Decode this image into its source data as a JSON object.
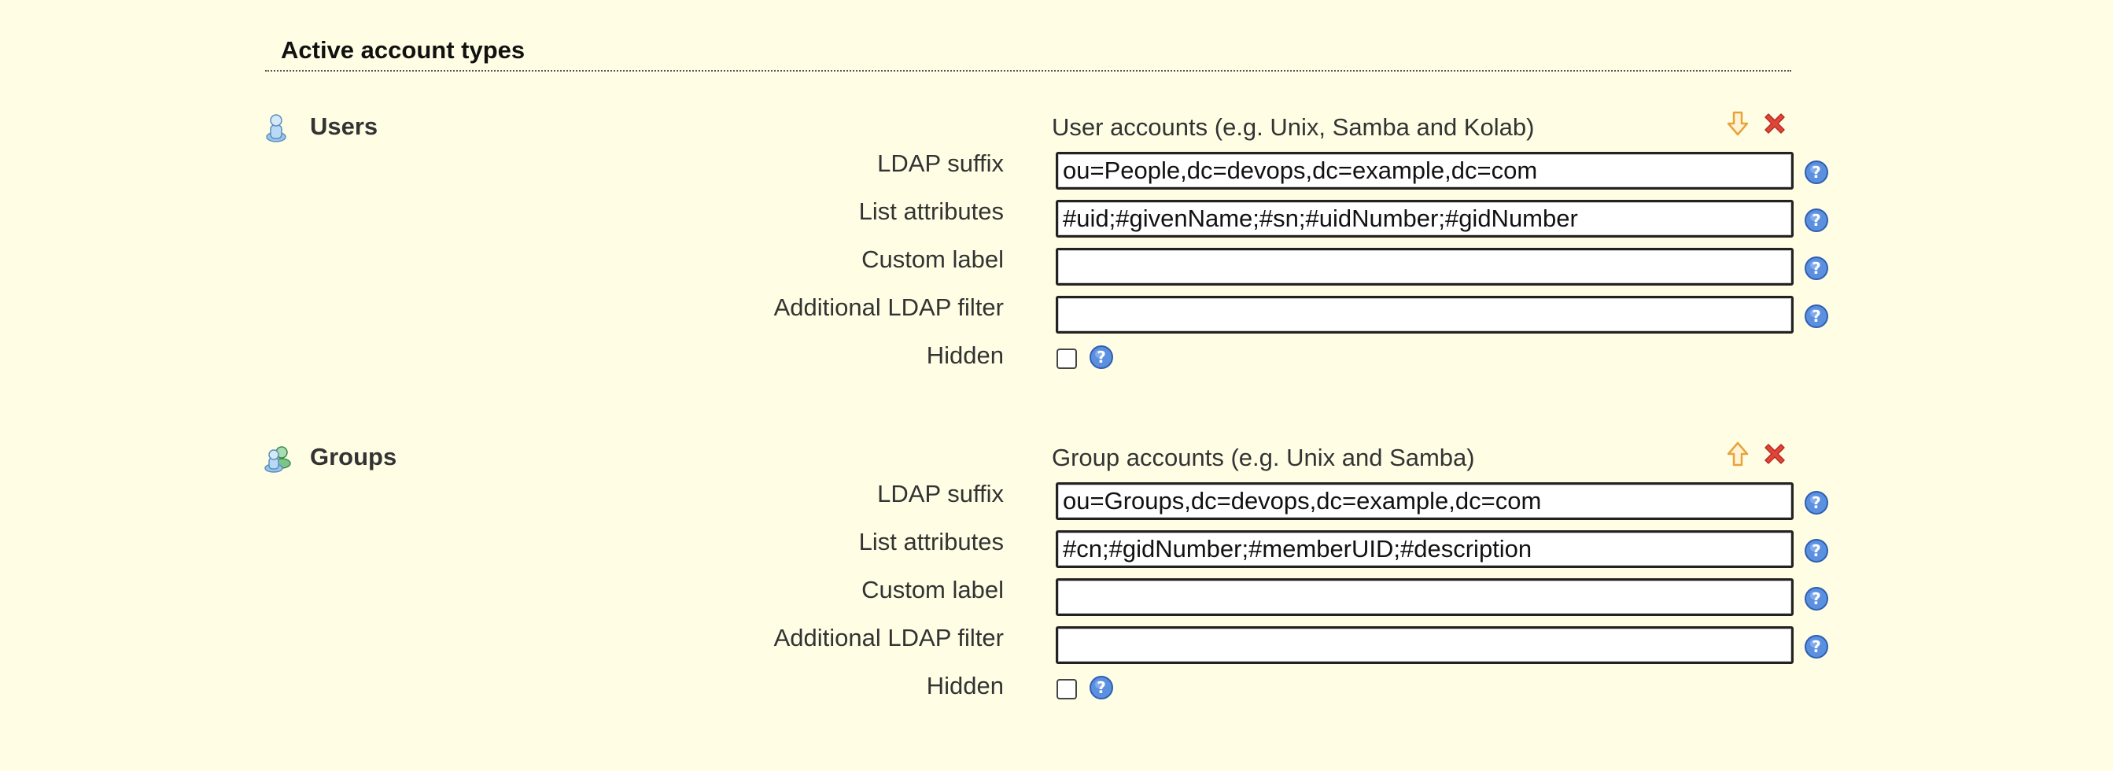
{
  "section": {
    "title": "Active account types"
  },
  "accounts": [
    {
      "name": "Users",
      "description": "User accounts (e.g. Unix, Samba and Kolab)",
      "move_direction": "down",
      "fields": {
        "ldap_suffix": {
          "label": "LDAP suffix",
          "value": "ou=People,dc=devops,dc=example,dc=com"
        },
        "list_attributes": {
          "label": "List attributes",
          "value": "#uid;#givenName;#sn;#uidNumber;#gidNumber"
        },
        "custom_label": {
          "label": "Custom label",
          "value": ""
        },
        "ldap_filter": {
          "label": "Additional LDAP filter",
          "value": ""
        },
        "hidden": {
          "label": "Hidden",
          "checked": false
        }
      }
    },
    {
      "name": "Groups",
      "description": "Group accounts (e.g. Unix and Samba)",
      "move_direction": "up",
      "fields": {
        "ldap_suffix": {
          "label": "LDAP suffix",
          "value": "ou=Groups,dc=devops,dc=example,dc=com"
        },
        "list_attributes": {
          "label": "List attributes",
          "value": "#cn;#gidNumber;#memberUID;#description"
        },
        "custom_label": {
          "label": "Custom label",
          "value": ""
        },
        "ldap_filter": {
          "label": "Additional LDAP filter",
          "value": ""
        },
        "hidden": {
          "label": "Hidden",
          "checked": false
        }
      }
    }
  ],
  "icons": {
    "user": "user-icon",
    "group": "group-icon",
    "move_down": "arrow-down-icon",
    "move_up": "arrow-up-icon",
    "delete": "delete-icon",
    "help": "help-icon"
  },
  "colors": {
    "background": "#fffee5",
    "arrow": "#e8a33b",
    "delete": "#d93b2b",
    "help": "#4a7fd8"
  }
}
